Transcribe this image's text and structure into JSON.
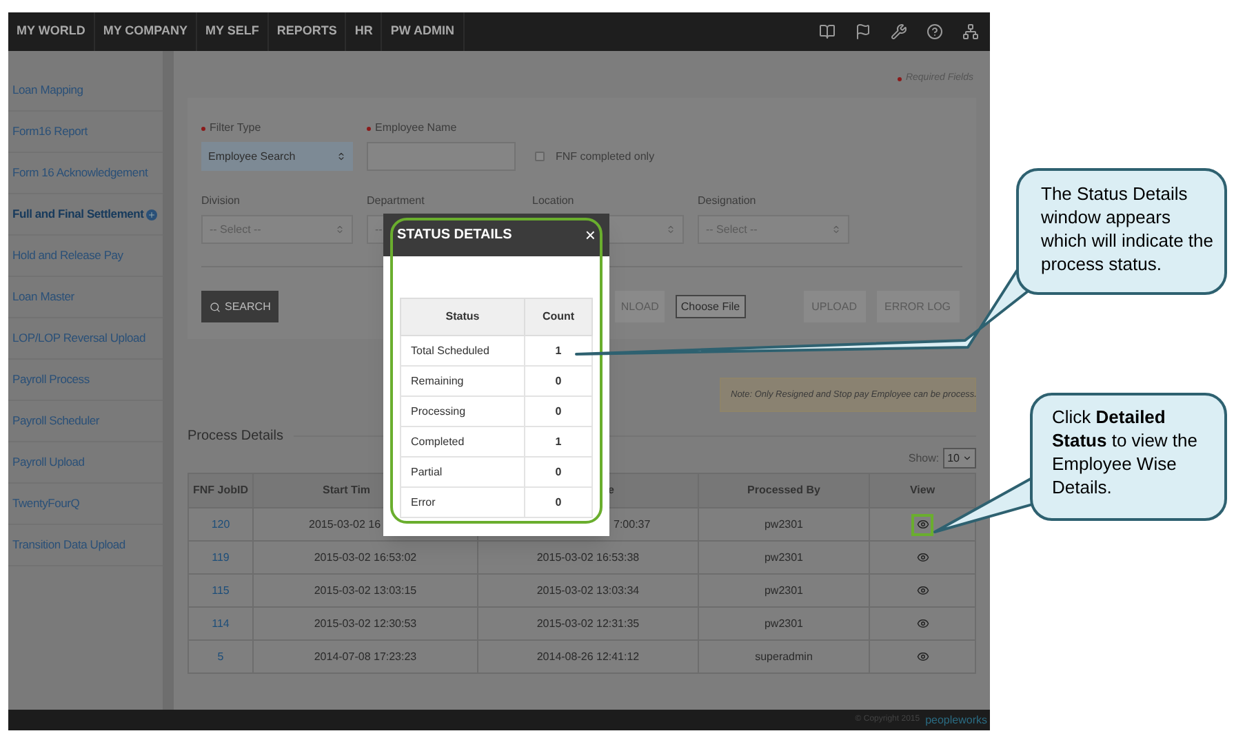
{
  "nav": {
    "items": [
      "MY WORLD",
      "MY COMPANY",
      "MY SELF",
      "REPORTS",
      "HR",
      "PW ADMIN"
    ]
  },
  "sidebar": {
    "items": [
      {
        "label": "Loan Mapping",
        "selected": false
      },
      {
        "label": "Form16 Report",
        "selected": false
      },
      {
        "label": "Form 16 Acknowledgement",
        "selected": false
      },
      {
        "label": "Full and Final Settlement",
        "selected": true
      },
      {
        "label": "Hold and Release Pay",
        "selected": false
      },
      {
        "label": "Loan Master",
        "selected": false
      },
      {
        "label": "LOP/LOP Reversal Upload",
        "selected": false
      },
      {
        "label": "Payroll Process",
        "selected": false
      },
      {
        "label": "Payroll Scheduler",
        "selected": false
      },
      {
        "label": "Payroll Upload",
        "selected": false
      },
      {
        "label": "TwentyFourQ",
        "selected": false
      },
      {
        "label": "Transition Data Upload",
        "selected": false
      }
    ]
  },
  "required_note": "Required Fields",
  "filters": {
    "filter_type": {
      "label": "Filter Type",
      "value": "Employee Search"
    },
    "employee_name": {
      "label": "Employee Name"
    },
    "fnf_checkbox": {
      "label": "FNF completed only",
      "checked": false
    },
    "selects": [
      {
        "label": "Division",
        "placeholder": "-- Select --"
      },
      {
        "label": "Department",
        "placeholder": "--"
      },
      {
        "label": "Location"
      },
      {
        "label": "Designation",
        "placeholder": "-- Select --"
      }
    ]
  },
  "buttons": {
    "search": "SEARCH",
    "download": "NLOAD",
    "choose_file": "Choose File",
    "upload": "UPLOAD",
    "error_log": "ERROR LOG"
  },
  "note": "Note: Only Resigned and Stop pay Employee can be process.",
  "process_details": {
    "title": "Process Details",
    "show_label": "Show:",
    "show_value": "10",
    "columns": [
      "FNF JobID",
      "Start Tim",
      "e",
      "Processed By",
      "View"
    ],
    "rows": [
      {
        "job_id": "120",
        "start": "2015-03-02 16",
        "end": "7:00:37",
        "processed_by": "pw2301",
        "highlighted": true
      },
      {
        "job_id": "119",
        "start": "2015-03-02 16:53:02",
        "end": "2015-03-02 16:53:38",
        "processed_by": "pw2301",
        "highlighted": false
      },
      {
        "job_id": "115",
        "start": "2015-03-02 13:03:15",
        "end": "2015-03-02 13:03:34",
        "processed_by": "pw2301",
        "highlighted": false
      },
      {
        "job_id": "114",
        "start": "2015-03-02 12:30:53",
        "end": "2015-03-02 12:31:35",
        "processed_by": "pw2301",
        "highlighted": false
      },
      {
        "job_id": "5",
        "start": "2014-07-08 17:23:23",
        "end": "2014-08-26 12:41:12",
        "processed_by": "superadmin",
        "highlighted": false
      }
    ]
  },
  "footer": {
    "copyright": "© Copyright 2015",
    "logo": "peopleworks"
  },
  "modal": {
    "title": "STATUS DETAILS",
    "close": "×",
    "columns": [
      "Status",
      "Count"
    ],
    "rows": [
      {
        "status": "Total Scheduled",
        "count": "1"
      },
      {
        "status": "Remaining",
        "count": "0"
      },
      {
        "status": "Processing",
        "count": "0"
      },
      {
        "status": "Completed",
        "count": "1"
      },
      {
        "status": "Partial",
        "count": "0"
      },
      {
        "status": "Error",
        "count": "0"
      }
    ]
  },
  "callouts": [
    "The Status Details window appears which will indicate the process status.",
    "Click **Detailed Status** to view the Employee Wise Details."
  ]
}
